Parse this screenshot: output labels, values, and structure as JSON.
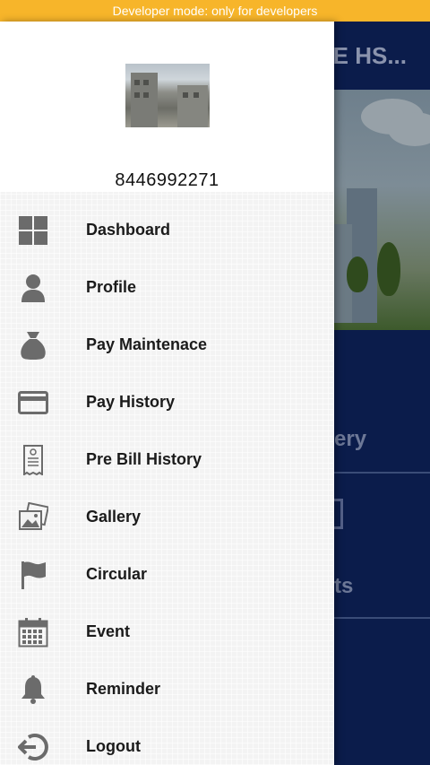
{
  "status_bar": {
    "dev_mode_text": "Developer mode: only for developers"
  },
  "background_app": {
    "header_title_visible": "YE HS...",
    "tiles": [
      {
        "label_fragment": "ery"
      },
      {
        "label_fragment": "ts"
      }
    ]
  },
  "drawer": {
    "profile": {
      "phone": "8446992271",
      "avatar": "society-building-photo"
    },
    "menu": [
      {
        "label": "Dashboard",
        "icon": "dashboard-grid-icon"
      },
      {
        "label": "Profile",
        "icon": "person-icon"
      },
      {
        "label": "Pay Maintenace",
        "icon": "money-bag-icon"
      },
      {
        "label": "Pay History",
        "icon": "credit-card-icon"
      },
      {
        "label": "Pre Bill History",
        "icon": "receipt-icon"
      },
      {
        "label": "Gallery",
        "icon": "photos-icon"
      },
      {
        "label": "Circular",
        "icon": "flag-icon"
      },
      {
        "label": "Event",
        "icon": "calendar-icon"
      },
      {
        "label": "Reminder",
        "icon": "bell-icon"
      },
      {
        "label": "Logout",
        "icon": "logout-icon"
      }
    ]
  },
  "colors": {
    "dev_bar": "#f7b52a",
    "app_primary": "#0e2257",
    "icon_gray": "#6b6b6b"
  }
}
